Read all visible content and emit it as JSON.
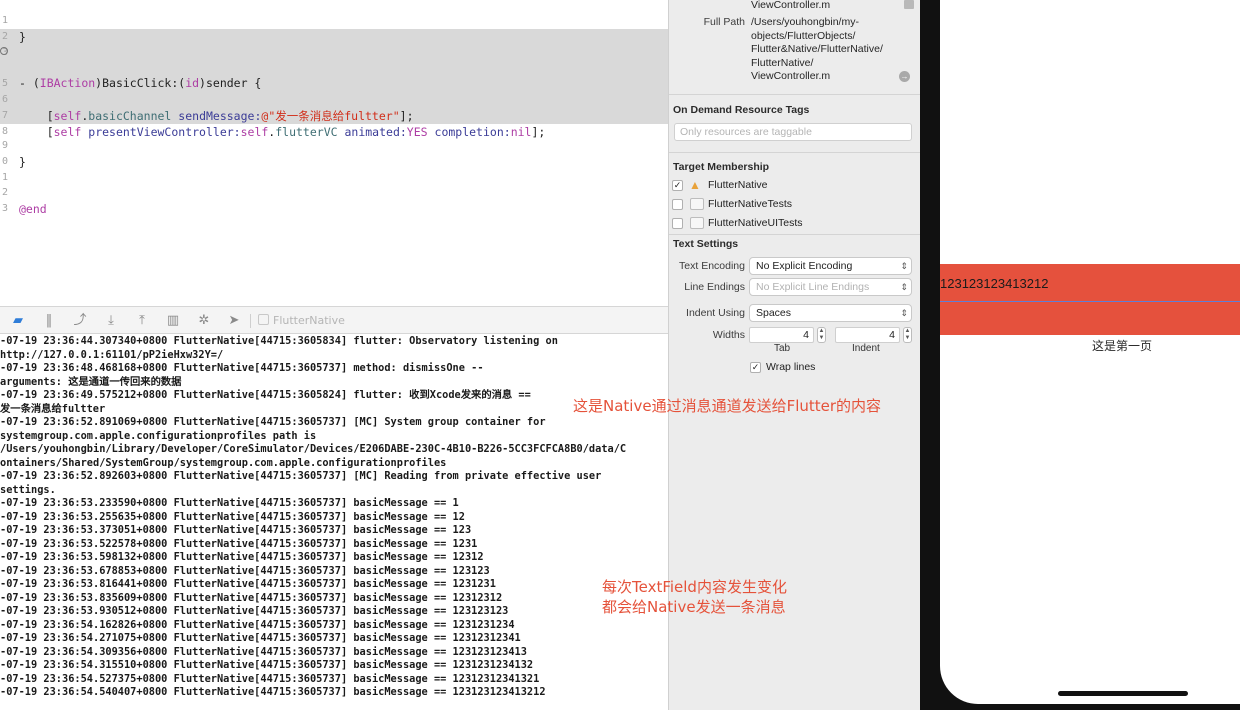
{
  "editor": {
    "lines": [
      {
        "num": "1",
        "text": "}"
      },
      {
        "num": "2",
        "text": ""
      },
      {
        "num": "3",
        "text": ""
      },
      {
        "num": "4",
        "text": "- (IBAction)BasicClick:(id)sender {"
      },
      {
        "num": "5",
        "text": ""
      },
      {
        "num": "6",
        "text": "    [self.basicChannel sendMessage:@\"发一条消息给fultter\"];"
      },
      {
        "num": "7",
        "text": "    [self presentViewController:self.flutterVC animated:YES completion:nil];"
      },
      {
        "num": "8",
        "text": ""
      },
      {
        "num": "9",
        "text": "}"
      },
      {
        "num": "0",
        "text": ""
      },
      {
        "num": "1",
        "text": ""
      },
      {
        "num": "2",
        "text": "@end"
      },
      {
        "num": "3",
        "text": ""
      }
    ]
  },
  "debug_bar": {
    "target": "FlutterNative"
  },
  "console": {
    "lines": [
      "-07-19 23:36:44.307340+0800 FlutterNative[44715:3605834] flutter: Observatory listening on",
      "http://127.0.0.1:61101/pP2ieHxw32Y=/",
      "-07-19 23:36:48.468168+0800 FlutterNative[44715:3605737] method: dismissOne --",
      "arguments: 这是通道一传回来的数据",
      "-07-19 23:36:49.575212+0800 FlutterNative[44715:3605824] flutter: 收到Xcode发来的消息 ==",
      "发一条消息给fultter",
      "-07-19 23:36:52.891069+0800 FlutterNative[44715:3605737] [MC] System group container for",
      "systemgroup.com.apple.configurationprofiles path is",
      "/Users/youhongbin/Library/Developer/CoreSimulator/Devices/E206DABE-230C-4B10-B226-5CC3FCFCA8B0/data/C",
      "ontainers/Shared/SystemGroup/systemgroup.com.apple.configurationprofiles",
      "-07-19 23:36:52.892603+0800 FlutterNative[44715:3605737] [MC] Reading from private effective user",
      "settings.",
      "-07-19 23:36:53.233590+0800 FlutterNative[44715:3605737] basicMessage == 1",
      "-07-19 23:36:53.255635+0800 FlutterNative[44715:3605737] basicMessage == 12",
      "-07-19 23:36:53.373051+0800 FlutterNative[44715:3605737] basicMessage == 123",
      "-07-19 23:36:53.522578+0800 FlutterNative[44715:3605737] basicMessage == 1231",
      "-07-19 23:36:53.598132+0800 FlutterNative[44715:3605737] basicMessage == 12312",
      "-07-19 23:36:53.678853+0800 FlutterNative[44715:3605737] basicMessage == 123123",
      "-07-19 23:36:53.816441+0800 FlutterNative[44715:3605737] basicMessage == 1231231",
      "-07-19 23:36:53.835609+0800 FlutterNative[44715:3605737] basicMessage == 12312312",
      "-07-19 23:36:53.930512+0800 FlutterNative[44715:3605737] basicMessage == 123123123",
      "-07-19 23:36:54.162826+0800 FlutterNative[44715:3605737] basicMessage == 1231231234",
      "-07-19 23:36:54.271075+0800 FlutterNative[44715:3605737] basicMessage == 12312312341",
      "-07-19 23:36:54.309356+0800 FlutterNative[44715:3605737] basicMessage == 123123123413",
      "-07-19 23:36:54.315510+0800 FlutterNative[44715:3605737] basicMessage == 1231231234132",
      "-07-19 23:36:54.527375+0800 FlutterNative[44715:3605737] basicMessage == 12312312341321",
      "-07-19 23:36:54.540407+0800 FlutterNative[44715:3605737] basicMessage == 123123123413212"
    ]
  },
  "inspector": {
    "file_name": "ViewController.m",
    "full_path_label": "Full Path",
    "full_path_lines": [
      "/Users/youhongbin/my-",
      "objects/FlutterObjects/",
      "Flutter&Native/FlutterNative/",
      "FlutterNative/",
      "ViewController.m"
    ],
    "on_demand": {
      "title": "On Demand Resource Tags",
      "placeholder": "Only resources are taggable"
    },
    "target_membership": {
      "title": "Target Membership",
      "items": [
        {
          "label": "FlutterNative",
          "checked": true,
          "checkmark": "✓"
        },
        {
          "label": "FlutterNativeTests",
          "checked": false,
          "checkmark": ""
        },
        {
          "label": "FlutterNativeUITests",
          "checked": false,
          "checkmark": ""
        }
      ]
    },
    "text_settings": {
      "title": "Text Settings",
      "text_encoding_label": "Text Encoding",
      "text_encoding_value": "No Explicit Encoding",
      "line_endings_label": "Line Endings",
      "line_endings_value": "No Explicit Line Endings",
      "indent_using_label": "Indent Using",
      "indent_using_value": "Spaces",
      "widths_label": "Widths",
      "tab_value": "4",
      "indent_value": "4",
      "tab_label": "Tab",
      "indent_label": "Indent",
      "wrap_lines_label": "Wrap lines",
      "wrap_checkmark": "✓"
    }
  },
  "simulator": {
    "textfield_value": "123123123413212",
    "page_label": "这是第一页",
    "field_color": "#e5513d"
  },
  "annotations": {
    "native_to_flutter": "这是Native通过消息通道发送给Flutter的内容",
    "textfield_change_line1": "每次TextField内容发生变化",
    "textfield_change_line2": "都会给Native发送一条消息"
  }
}
